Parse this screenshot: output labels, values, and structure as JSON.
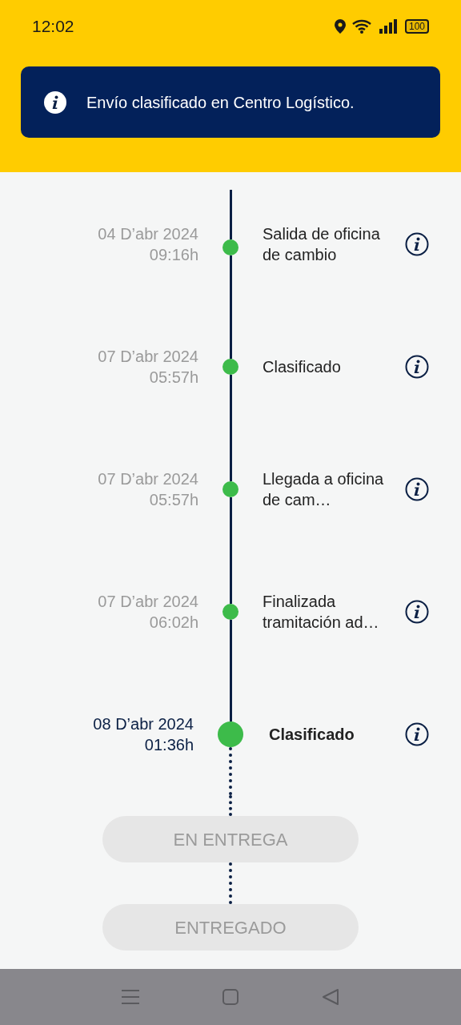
{
  "status_bar": {
    "time": "12:02",
    "battery": "100"
  },
  "toast": {
    "message": "Envío clasificado en Centro Logístico."
  },
  "events": [
    {
      "date": "04 D’abr 2024",
      "time": "09:16h",
      "label": "Salida de oficina de cambio",
      "current": false
    },
    {
      "date": "07 D’abr 2024",
      "time": "05:57h",
      "label": "Clasificado",
      "current": false
    },
    {
      "date": "07 D’abr 2024",
      "time": "05:57h",
      "label": "Llegada a oficina de cam…",
      "current": false
    },
    {
      "date": "07 D’abr 2024",
      "time": "06:02h",
      "label": "Finalizada tramitación ad…",
      "current": false
    },
    {
      "date": "08 D’abr 2024",
      "time": "01:36h",
      "label": "Clasificado",
      "current": true
    }
  ],
  "pending_steps": [
    {
      "label": "EN ENTREGA",
      "disabled": true
    },
    {
      "label": "ENTREGADO",
      "disabled": true
    }
  ]
}
